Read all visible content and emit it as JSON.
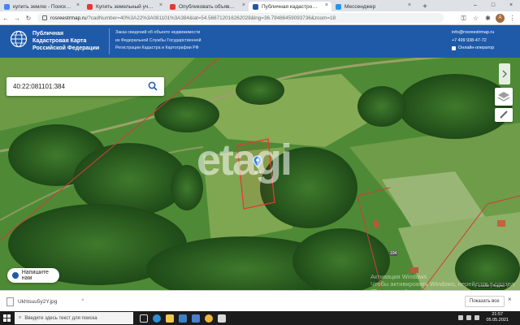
{
  "browser": {
    "tabs": [
      {
        "label": "купить землю - Поиск в Google",
        "favicon_color": "#4285f4",
        "active": false
      },
      {
        "label": "Купить земельный участок в Ка…",
        "favicon_color": "#e53935",
        "active": false
      },
      {
        "label": "Опубликовать объявление",
        "favicon_color": "#e53935",
        "active": false
      },
      {
        "label": "Публичная кадастровая карта",
        "favicon_color": "#1f5aa8",
        "active": true
      },
      {
        "label": "Мессенджер",
        "favicon_color": "#2196f3",
        "active": false
      }
    ],
    "new_tab": "+",
    "tab_close": "×",
    "window_controls": {
      "minimize": "–",
      "maximize": "□",
      "close": "×"
    },
    "url_host": "rosreestrmap.ru",
    "url_rest": "/?cadNumber=40%3A22%3A081101%3A384&lat=54.566712016262028&lng=36.79486459093736&zoom=18",
    "avatar_letter": "A"
  },
  "site": {
    "title_lines": [
      "Публичная",
      "Кадастровая Карта",
      "Российской Федерации"
    ],
    "description_lines": [
      "Заказ сведений об объекте недвижимости",
      "из Федеральной Службы Государственной",
      "Регистрации Кадастра и Картографии РФ"
    ],
    "email": "info@rosreestrmap.ru",
    "phone": "+7 499 938-47-72",
    "online_operator": "Онлайн-оператор"
  },
  "map": {
    "search_value": "40:22:081101:384",
    "parcel_label": "384",
    "road_label": "104",
    "chat_label": "Напишите нам",
    "watermark": "etagi",
    "activation_lines": [
      "Активация Windows",
      "Чтобы активировать Windows, перейдите в раздел",
      "\"Параметры\"."
    ],
    "attribution": "Leaflet | Яндекс"
  },
  "downloads": {
    "file_name": "Ukhtsuu5y2Y.jpg",
    "show_all": "Показать все",
    "close": "×"
  },
  "taskbar": {
    "search_placeholder": "Введите здесь текст для поиска",
    "time": "21:57",
    "date": "05.05.2021"
  },
  "colors": {
    "header_blue": "#1f5aa8",
    "parcel_red": "#e53935"
  }
}
